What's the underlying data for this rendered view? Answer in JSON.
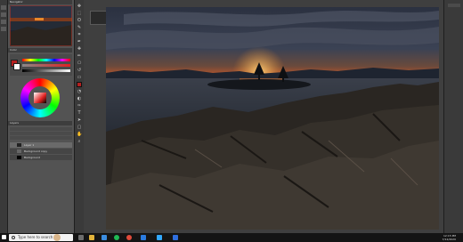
{
  "app": {
    "name": "Adobe Photoshop"
  },
  "panels": {
    "tabs": [
      "Navigator",
      "Color",
      "Layers"
    ],
    "layers": [
      {
        "name": "Layer 1"
      },
      {
        "name": "Background copy"
      },
      {
        "name": "Background"
      }
    ]
  },
  "taskbar": {
    "search_placeholder": "Type here to search",
    "time": "12:15 PM",
    "date": "7/12/2020"
  },
  "colors": {
    "panel_bg": "#535353",
    "workspace_bg": "#3f3f3f",
    "foreground_swatch": "#b62020",
    "background_swatch": "#ffffff",
    "accent": "#e8872a"
  },
  "icons": [
    "windows-start-icon",
    "search-icon",
    "task-view-icon",
    "file-explorer-icon",
    "edge-icon",
    "photoshop-icon",
    "lightroom-icon",
    "spotify-icon",
    "chrome-icon",
    "mail-icon"
  ]
}
